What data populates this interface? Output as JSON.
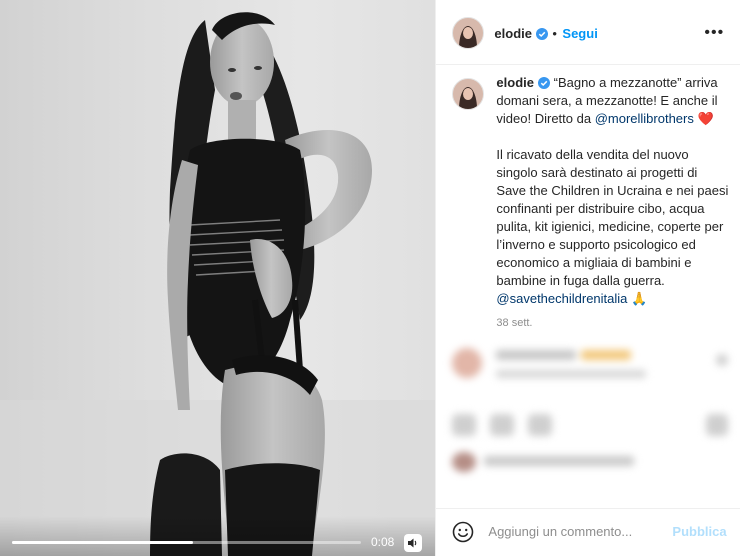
{
  "video": {
    "time": "0:08",
    "progress": 0.52,
    "controls": {
      "play": "play-button",
      "volume": "speaker-icon"
    }
  },
  "header": {
    "username": "elodie",
    "separator": "•",
    "follow_label": "Segui",
    "more_label": "•••"
  },
  "caption": {
    "username": "elodie",
    "text_part1": "“Bagno a mezzanotte” arriva domani sera, a mezzanotte! E anche il video! Diretto da ",
    "mention1": "@morellibrothers",
    "heart": "❤️",
    "text_part2": "Il ricavato della vendita del nuovo singolo sarà destinato ai progetti di Save the Children in Ucraina e nei paesi confinanti per distribuire cibo, acqua pulita, kit igienici, medicine, coperte per l’inverno e supporto psicologico ed economico a migliaia di bambini e bambine in fuga dalla guerra. ",
    "mention2": "@savethechildrenitalia",
    "pray": "🙏",
    "time_ago": "38 sett."
  },
  "composer": {
    "placeholder": "Aggiungi un commento...",
    "publish_label": "Pubblica",
    "emoji_icon": "smiley-icon"
  },
  "colors": {
    "accent": "#0095f6",
    "mention": "#00376b",
    "publish_disabled": "#b2dffc",
    "secondary_text": "#8e8e8e",
    "verified": "#3897f0",
    "heart": "#ed4956"
  }
}
